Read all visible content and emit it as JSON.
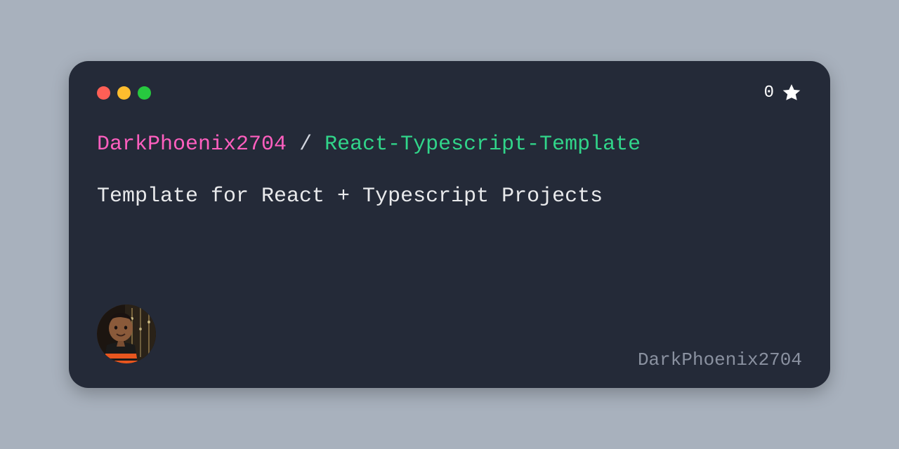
{
  "header": {
    "stars_count": "0"
  },
  "repo": {
    "owner": "DarkPhoenix2704",
    "separator": "/",
    "name": "React-Typescript-Template",
    "description": "Template for React + Typescript Projects"
  },
  "footer": {
    "username": "DarkPhoenix2704"
  }
}
